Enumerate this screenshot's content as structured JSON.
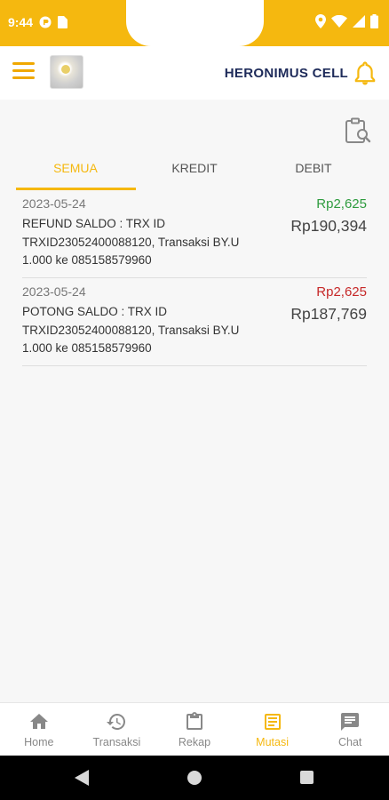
{
  "status_bar": {
    "time": "9:44"
  },
  "header": {
    "store_name": "HERONIMUS CELL"
  },
  "tabs": [
    {
      "label": "SEMUA"
    },
    {
      "label": "KREDIT"
    },
    {
      "label": "DEBIT"
    }
  ],
  "transactions": [
    {
      "date": "2023-05-24",
      "description": "REFUND SALDO : TRX ID TRXID23052400088120, Transaksi BY.U 1.000 ke 085158579960",
      "amount": "Rp2,625",
      "balance": "Rp190,394"
    },
    {
      "date": "2023-05-24",
      "description": "POTONG SALDO : TRX ID TRXID23052400088120, Transaksi BY.U 1.000 ke 085158579960",
      "amount": "Rp2,625",
      "balance": "Rp187,769"
    }
  ],
  "bottom_nav": [
    {
      "label": "Home",
      "icon": "home-icon"
    },
    {
      "label": "Transaksi",
      "icon": "history-icon"
    },
    {
      "label": "Rekap",
      "icon": "clipboard-icon"
    },
    {
      "label": "Mutasi",
      "icon": "document-icon"
    },
    {
      "label": "Chat",
      "icon": "chat-icon"
    }
  ],
  "colors": {
    "accent": "#f5b80f",
    "credit": "#2e9b3e",
    "debit": "#c62828",
    "title": "#1e2b5a"
  }
}
